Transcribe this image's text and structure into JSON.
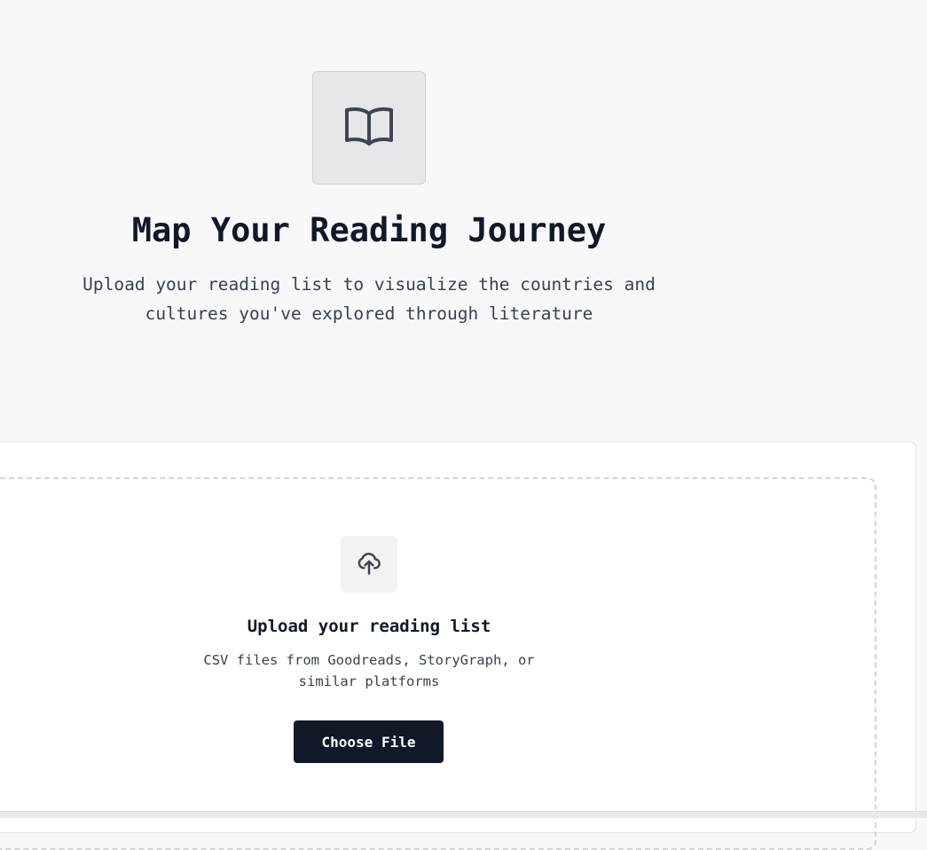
{
  "hero": {
    "icon": "book-open-icon",
    "title": "Map Your Reading Journey",
    "subtitle": "Upload your reading list to visualize the countries and cultures you've explored through literature"
  },
  "upload": {
    "icon": "cloud-upload-icon",
    "title": "Upload your reading list",
    "description": "CSV files from Goodreads, StoryGraph, or similar platforms",
    "button_label": "Choose File"
  },
  "colors": {
    "background": "#f7f8fa",
    "text_primary": "#111827",
    "text_secondary": "#374151",
    "button_bg": "#111827",
    "icon_box_bg": "#e5e7eb"
  }
}
